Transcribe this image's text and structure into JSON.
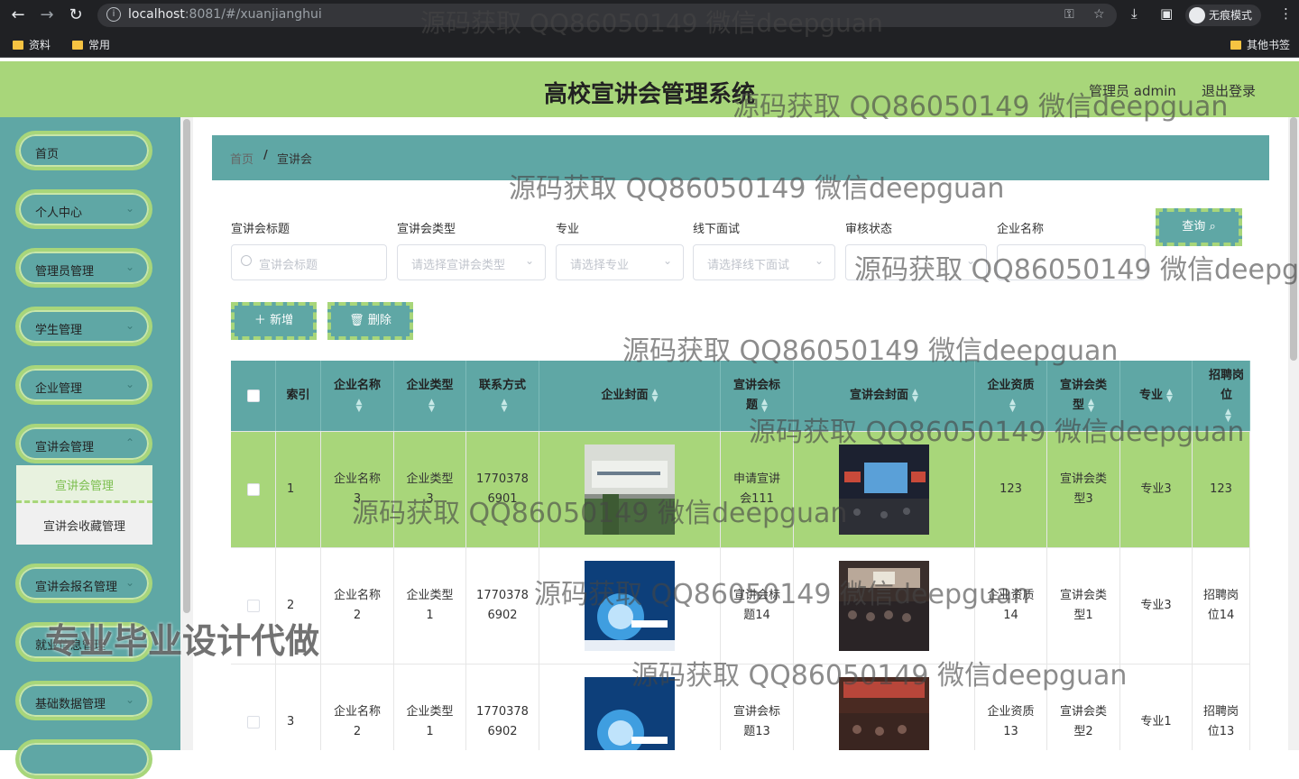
{
  "browser": {
    "url_host": "localhost",
    "url_rest": ":8081/#/xuanjianghui",
    "incognito_label": "无痕模式",
    "bookmarks": [
      "资料",
      "常用"
    ],
    "other_bookmarks": "其他书签"
  },
  "header": {
    "title": "高校宣讲会管理系统",
    "user": "管理员 admin",
    "logout": "退出登录"
  },
  "sidebar": {
    "items": [
      "首页",
      "个人中心",
      "管理员管理",
      "学生管理",
      "企业管理",
      "宣讲会管理",
      "宣讲会报名管理",
      "就业信息管理",
      "基础数据管理"
    ],
    "submenu": [
      "宣讲会管理",
      "宣讲会收藏管理"
    ]
  },
  "breadcrumb": {
    "home": "首页",
    "separator": "/",
    "current": "宣讲会"
  },
  "filters": {
    "labels": [
      "宣讲会标题",
      "宣讲会类型",
      "专业",
      "线下面试",
      "审核状态",
      "企业名称"
    ],
    "placeholders": [
      "宣讲会标题",
      "请选择宣讲会类型",
      "请选择专业",
      "请选择线下面试",
      "",
      ""
    ],
    "search_button": "查询"
  },
  "actions": {
    "add": "新增",
    "delete": "删除"
  },
  "table": {
    "columns": [
      "索引",
      "企业名称",
      "企业类型",
      "联系方式",
      "企业封面",
      "宣讲会标题",
      "宣讲会封面",
      "企业资质",
      "宣讲会类型",
      "专业",
      "招聘岗位"
    ],
    "rows": [
      {
        "index": "1",
        "company": "企业名称3",
        "type": "企业类型3",
        "phone": "17703786901",
        "title": "申请宣讲会111",
        "qualification": "123",
        "xtype": "宣讲会类型3",
        "major": "专业3",
        "position": "123"
      },
      {
        "index": "2",
        "company": "企业名称2",
        "type": "企业类型1",
        "phone": "17703786902",
        "title": "宣讲会标题14",
        "qualification": "企业资质14",
        "xtype": "宣讲会类型1",
        "major": "专业3",
        "position": "招聘岗位14"
      },
      {
        "index": "3",
        "company": "企业名称2",
        "type": "企业类型1",
        "phone": "17703786902",
        "title": "宣讲会标题13",
        "qualification": "企业资质13",
        "xtype": "宣讲会类型2",
        "major": "专业1",
        "position": "招聘岗位13"
      }
    ]
  },
  "watermarks": {
    "text": "源码获取 QQ86050149 微信deepguan",
    "promo": "专业毕业设计代做"
  },
  "colors": {
    "header_green": "#a8d67a",
    "teal": "#5fa7a5",
    "highlight_row": "#a8d67a"
  }
}
